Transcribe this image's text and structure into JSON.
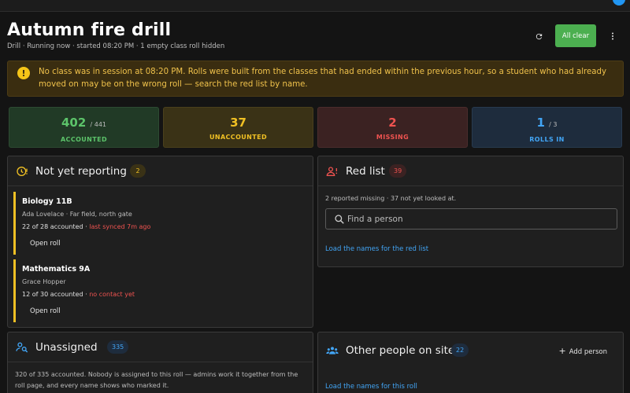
{
  "header": {
    "title": "Autumn fire drill",
    "subtitle": "Drill · Running now · started 08:20 PM · 1 empty class roll hidden",
    "all_clear_label": "All clear",
    "refresh_icon": "refresh-icon",
    "more_icon": "more-vert-icon"
  },
  "alert": {
    "icon": "warning-icon",
    "text": "No class was in session at 08:20 PM. Rolls were built from the classes that had ended within the previous hour, so a student who had already moved on may be on the wrong roll — search the red list by name."
  },
  "stats": {
    "accounted": {
      "value": "402",
      "total": "/ 441",
      "label": "ACCOUNTED"
    },
    "unaccounted": {
      "value": "37",
      "label": "UNACCOUNTED"
    },
    "missing": {
      "value": "2",
      "label": "MISSING"
    },
    "rolls_in": {
      "value": "1",
      "total": "/ 3",
      "label": "ROLLS IN"
    }
  },
  "not_reporting": {
    "title": "Not yet reporting",
    "count": "2",
    "icon": "clock-alert-icon",
    "rolls": [
      {
        "class_name": "Biology 11B",
        "teacher": "Ada Lovelace · Far field, north gate",
        "count": "22 of 28 accounted",
        "sync": "last synced 7m ago",
        "open_label": "Open roll"
      },
      {
        "class_name": "Mathematics 9A",
        "teacher": "Grace Hopper",
        "count": "12 of 30 accounted",
        "sync": "no contact yet",
        "open_label": "Open roll"
      }
    ]
  },
  "red_list": {
    "title": "Red list",
    "count": "39",
    "icon": "person-alert-icon",
    "summary": "2 reported missing · 37 not yet looked at.",
    "search_placeholder": "Find a person",
    "load_label": "Load the names for the red list"
  },
  "unassigned": {
    "title": "Unassigned",
    "count": "335",
    "icon": "person-search-icon",
    "text": "320 of 335 accounted. Nobody is assigned to this roll — admins work it together from the roll page, and every name shows who marked it."
  },
  "others": {
    "title": "Other people on site",
    "count": "22",
    "icon": "group-icon",
    "add_label": "Add person",
    "load_label": "Load the names for this roll"
  },
  "colors": {
    "green": "#4caf50",
    "yellow": "#f0c024",
    "red": "#ef5350",
    "blue": "#42a5f5"
  }
}
